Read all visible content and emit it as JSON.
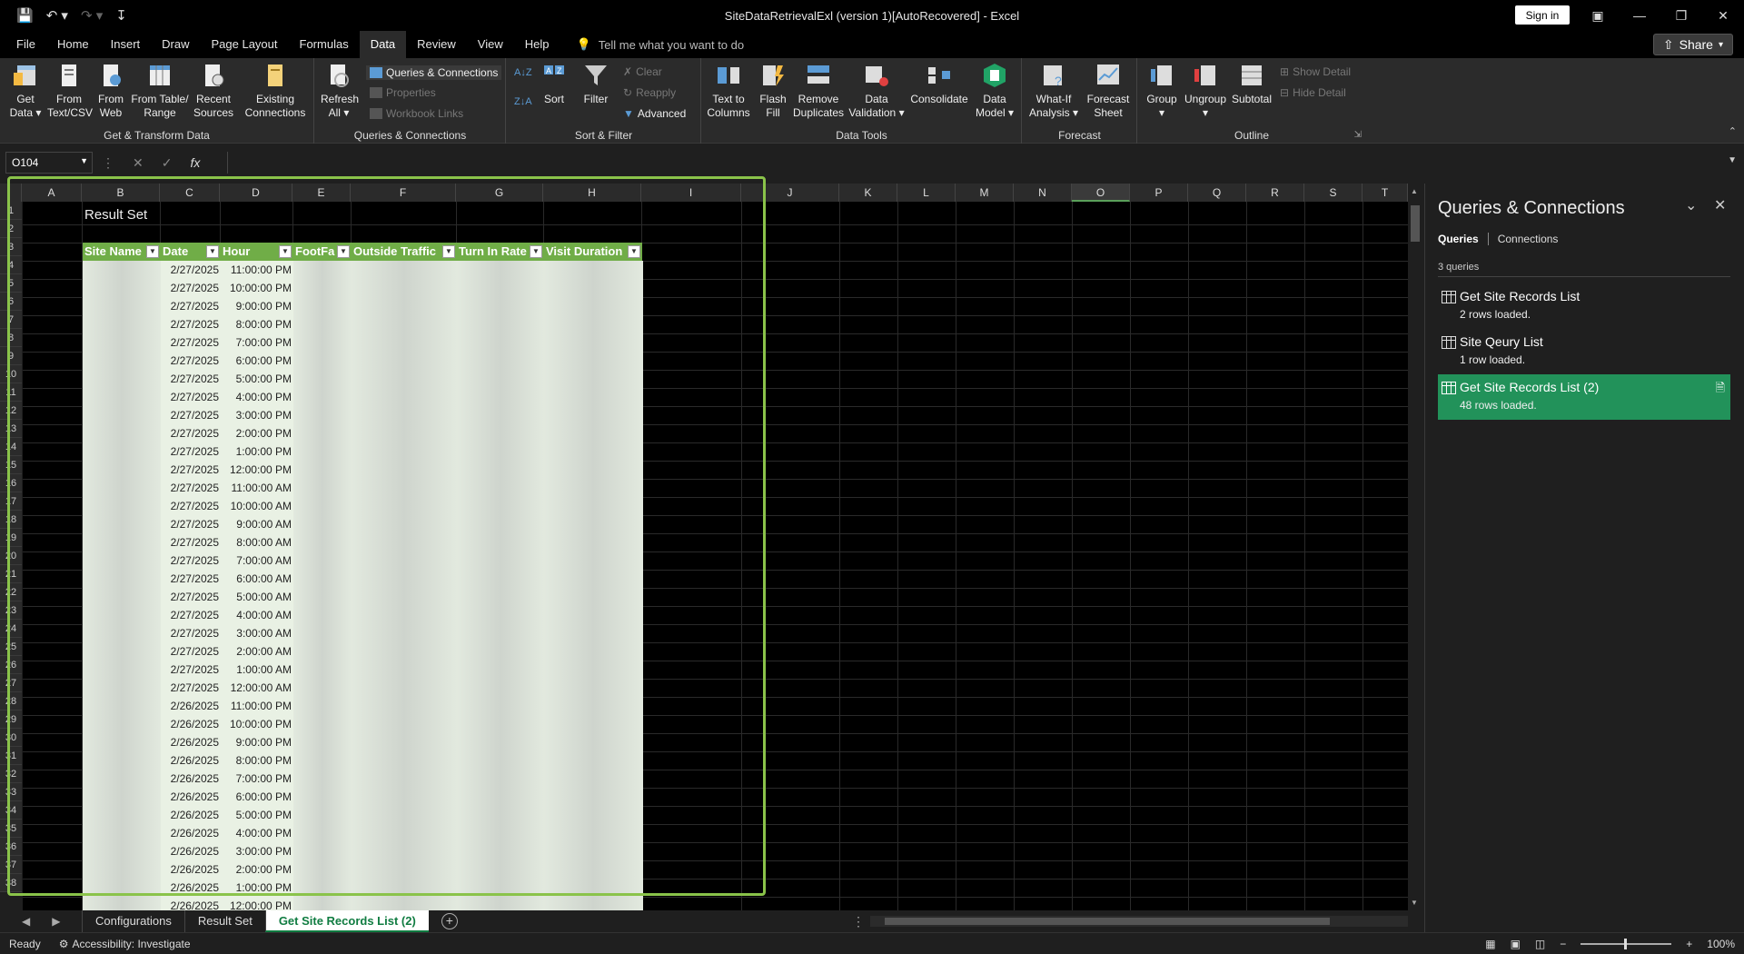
{
  "window": {
    "title": "SiteDataRetrievalExl (version 1)[AutoRecovered]  -  Excel",
    "sign_in": "Sign in",
    "share": "Share"
  },
  "menu": {
    "items": [
      "File",
      "Home",
      "Insert",
      "Draw",
      "Page Layout",
      "Formulas",
      "Data",
      "Review",
      "View",
      "Help"
    ],
    "active": "Data",
    "tell_me": "Tell me what you want to do"
  },
  "ribbon": {
    "get_transform": {
      "label": "Get & Transform Data",
      "get_data": "Get Data",
      "from_text": "From Text/CSV",
      "from_web": "From Web",
      "from_table": "From Table/ Range",
      "recent_sources": "Recent Sources",
      "existing_connections": "Existing Connections"
    },
    "queries": {
      "label": "Queries & Connections",
      "refresh_all": "Refresh All",
      "queries_connections": "Queries & Connections",
      "properties": "Properties",
      "workbook_links": "Workbook Links"
    },
    "sort_filter": {
      "label": "Sort & Filter",
      "sort": "Sort",
      "filter": "Filter",
      "clear": "Clear",
      "reapply": "Reapply",
      "advanced": "Advanced"
    },
    "data_tools": {
      "label": "Data Tools",
      "text_to_columns": "Text to Columns",
      "flash_fill": "Flash Fill",
      "remove_duplicates": "Remove Duplicates",
      "data_validation": "Data Validation",
      "consolidate": "Consolidate",
      "data_model": "Data Model"
    },
    "forecast": {
      "label": "Forecast",
      "what_if": "What-If Analysis",
      "forecast_sheet": "Forecast Sheet"
    },
    "outline": {
      "label": "Outline",
      "group": "Group",
      "ungroup": "Ungroup",
      "subtotal": "Subtotal",
      "show_detail": "Show Detail",
      "hide_detail": "Hide Detail"
    }
  },
  "formula_bar": {
    "name_box": "O104",
    "formula": ""
  },
  "grid": {
    "columns": [
      "A",
      "B",
      "C",
      "D",
      "E",
      "F",
      "G",
      "H",
      "I",
      "J",
      "K",
      "L",
      "M",
      "N",
      "O",
      "P",
      "Q",
      "R",
      "S",
      "T"
    ],
    "selected_column": "O",
    "row_numbers": [
      "1",
      "2",
      "3",
      "4",
      "5",
      "6",
      "7",
      "8",
      "9",
      "10",
      "11",
      "12",
      "13",
      "14",
      "15",
      "16",
      "17",
      "18",
      "19",
      "20",
      "21",
      "22",
      "23",
      "24",
      "25",
      "26",
      "27",
      "28",
      "29",
      "30",
      "31",
      "32",
      "33",
      "34",
      "35",
      "36",
      "37",
      "38"
    ]
  },
  "sheet": {
    "title": "Result Set",
    "headers": [
      "Site Name",
      "Date",
      "Hour",
      "FootFa",
      "Outside Traffic",
      "Turn In Rate",
      "Visit Duration"
    ],
    "rows": [
      {
        "date": "2/27/2025",
        "hour": "11:00:00 PM"
      },
      {
        "date": "2/27/2025",
        "hour": "10:00:00 PM"
      },
      {
        "date": "2/27/2025",
        "hour": "9:00:00 PM"
      },
      {
        "date": "2/27/2025",
        "hour": "8:00:00 PM"
      },
      {
        "date": "2/27/2025",
        "hour": "7:00:00 PM"
      },
      {
        "date": "2/27/2025",
        "hour": "6:00:00 PM"
      },
      {
        "date": "2/27/2025",
        "hour": "5:00:00 PM"
      },
      {
        "date": "2/27/2025",
        "hour": "4:00:00 PM"
      },
      {
        "date": "2/27/2025",
        "hour": "3:00:00 PM"
      },
      {
        "date": "2/27/2025",
        "hour": "2:00:00 PM"
      },
      {
        "date": "2/27/2025",
        "hour": "1:00:00 PM"
      },
      {
        "date": "2/27/2025",
        "hour": "12:00:00 PM"
      },
      {
        "date": "2/27/2025",
        "hour": "11:00:00 AM"
      },
      {
        "date": "2/27/2025",
        "hour": "10:00:00 AM"
      },
      {
        "date": "2/27/2025",
        "hour": "9:00:00 AM"
      },
      {
        "date": "2/27/2025",
        "hour": "8:00:00 AM"
      },
      {
        "date": "2/27/2025",
        "hour": "7:00:00 AM"
      },
      {
        "date": "2/27/2025",
        "hour": "6:00:00 AM"
      },
      {
        "date": "2/27/2025",
        "hour": "5:00:00 AM"
      },
      {
        "date": "2/27/2025",
        "hour": "4:00:00 AM"
      },
      {
        "date": "2/27/2025",
        "hour": "3:00:00 AM"
      },
      {
        "date": "2/27/2025",
        "hour": "2:00:00 AM"
      },
      {
        "date": "2/27/2025",
        "hour": "1:00:00 AM"
      },
      {
        "date": "2/27/2025",
        "hour": "12:00:00 AM"
      },
      {
        "date": "2/26/2025",
        "hour": "11:00:00 PM"
      },
      {
        "date": "2/26/2025",
        "hour": "10:00:00 PM"
      },
      {
        "date": "2/26/2025",
        "hour": "9:00:00 PM"
      },
      {
        "date": "2/26/2025",
        "hour": "8:00:00 PM"
      },
      {
        "date": "2/26/2025",
        "hour": "7:00:00 PM"
      },
      {
        "date": "2/26/2025",
        "hour": "6:00:00 PM"
      },
      {
        "date": "2/26/2025",
        "hour": "5:00:00 PM"
      },
      {
        "date": "2/26/2025",
        "hour": "4:00:00 PM"
      },
      {
        "date": "2/26/2025",
        "hour": "3:00:00 PM"
      },
      {
        "date": "2/26/2025",
        "hour": "2:00:00 PM"
      },
      {
        "date": "2/26/2025",
        "hour": "1:00:00 PM"
      },
      {
        "date": "2/26/2025",
        "hour": "12:00:00 PM"
      }
    ]
  },
  "sheet_tabs": {
    "tabs": [
      "Configurations",
      "Result Set",
      "Get Site Records List (2)"
    ],
    "active": "Get Site Records List (2)"
  },
  "status": {
    "ready": "Ready",
    "accessibility": "Accessibility: Investigate",
    "zoom": "100%"
  },
  "queries_pane": {
    "title": "Queries & Connections",
    "tab_queries": "Queries",
    "tab_connections": "Connections",
    "count": "3 queries",
    "items": [
      {
        "name": "Get Site Records List",
        "rows": "2 rows loaded."
      },
      {
        "name": "Site Qeury List",
        "rows": "1 row loaded."
      },
      {
        "name": "Get Site Records List (2)",
        "rows": "48 rows loaded."
      }
    ]
  },
  "colors": {
    "accent_green": "#22925a",
    "table_header": "#70ad47",
    "highlight_box": "#8ac34a"
  }
}
